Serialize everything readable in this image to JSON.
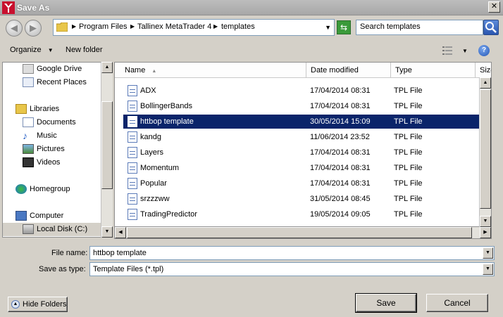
{
  "window": {
    "title": "Save As"
  },
  "address": {
    "crumbs": [
      "Program Files",
      "Tallinex MetaTrader 4",
      "templates"
    ],
    "search_placeholder": "Search templates"
  },
  "toolbar": {
    "organize": "Organize",
    "new_folder": "New folder"
  },
  "nav": {
    "items": [
      {
        "label": "Google Drive",
        "icon": "drive-icon"
      },
      {
        "label": "Recent Places",
        "icon": "recent-places-icon"
      },
      {
        "label": "Libraries",
        "icon": "libraries-icon"
      },
      {
        "label": "Documents",
        "icon": "documents-icon"
      },
      {
        "label": "Music",
        "icon": "music-icon"
      },
      {
        "label": "Pictures",
        "icon": "pictures-icon"
      },
      {
        "label": "Videos",
        "icon": "videos-icon"
      },
      {
        "label": "Homegroup",
        "icon": "homegroup-icon"
      },
      {
        "label": "Computer",
        "icon": "computer-icon"
      },
      {
        "label": "Local Disk (C:)",
        "icon": "disk-icon"
      }
    ]
  },
  "columns": {
    "name": "Name",
    "date": "Date modified",
    "type": "Type",
    "size": "Size"
  },
  "files": [
    {
      "name": "ADX",
      "date": "17/04/2014 08:31",
      "type": "TPL File"
    },
    {
      "name": "BollingerBands",
      "date": "17/04/2014 08:31",
      "type": "TPL File"
    },
    {
      "name": "httbop template",
      "date": "30/05/2014 15:09",
      "type": "TPL File"
    },
    {
      "name": "kandg",
      "date": "11/06/2014 23:52",
      "type": "TPL File"
    },
    {
      "name": "Layers",
      "date": "17/04/2014 08:31",
      "type": "TPL File"
    },
    {
      "name": "Momentum",
      "date": "17/04/2014 08:31",
      "type": "TPL File"
    },
    {
      "name": "Popular",
      "date": "17/04/2014 08:31",
      "type": "TPL File"
    },
    {
      "name": "srzzzww",
      "date": "31/05/2014 08:45",
      "type": "TPL File"
    },
    {
      "name": "TradingPredictor",
      "date": "19/05/2014 09:05",
      "type": "TPL File"
    }
  ],
  "form": {
    "filename_label": "File name:",
    "filename_value": "httbop template",
    "savetype_label": "Save as type:",
    "savetype_value": "Template Files (*.tpl)"
  },
  "buttons": {
    "hide_folders": "Hide Folders",
    "save": "Save",
    "cancel": "Cancel"
  }
}
